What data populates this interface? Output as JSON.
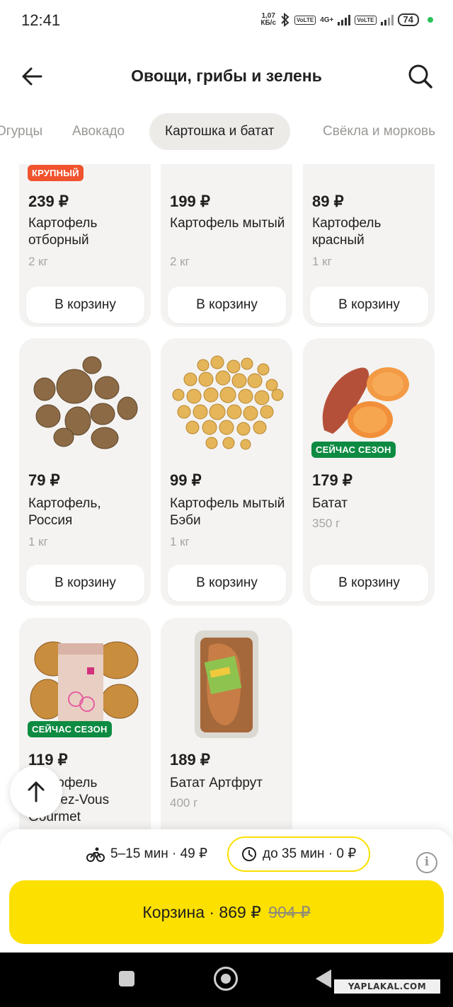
{
  "status_bar": {
    "time": "12:41",
    "net_speed_top": "1,07",
    "net_speed_bottom": "КБ/с",
    "network": "4G+",
    "lte_badge": "VoLTE",
    "battery": "74"
  },
  "header": {
    "title": "Овощи, грибы и зелень",
    "back_icon": "arrow-left-icon",
    "search_icon": "search-icon"
  },
  "tabs": [
    {
      "label": "Огурцы",
      "active": false
    },
    {
      "label": "Авокадо",
      "active": false
    },
    {
      "label": "Картошка и батат",
      "active": true
    },
    {
      "label": "Свёкла и морковь",
      "active": false
    }
  ],
  "products": [
    {
      "price": "239 ₽",
      "name": "Картофель отборный",
      "weight": "2 кг",
      "badge": "КРУПНЫЙ",
      "button": "В корзину"
    },
    {
      "price": "199 ₽",
      "name": "Картофель мытый",
      "weight": "2 кг",
      "badge": "",
      "button": "В корзину"
    },
    {
      "price": "89 ₽",
      "name": "Картофель красный",
      "weight": "1 кг",
      "badge": "",
      "button": "В корзину"
    },
    {
      "price": "79 ₽",
      "name": "Картофель, Россия",
      "weight": "1 кг",
      "badge": "",
      "button": "В корзину"
    },
    {
      "price": "99 ₽",
      "name": "Картофель мытый Бэби",
      "weight": "1 кг",
      "badge": "",
      "button": "В корзину"
    },
    {
      "price": "179 ₽",
      "name": "Батат",
      "weight": "350 г",
      "badge": "СЕЙЧАС СЕЗОН",
      "button": "В корзину"
    },
    {
      "price": "119 ₽",
      "name": "Картофель Rendez-Vous Gourmet",
      "weight": "",
      "badge": "СЕЙЧАС СЕЗОН",
      "button": ""
    },
    {
      "price": "189 ₽",
      "name": "Батат Артфрут",
      "weight": "400 г",
      "badge": "",
      "button": ""
    }
  ],
  "delivery": {
    "fast_label": "5–15 мин · 49 ₽",
    "slow_label": "до 35 мин · 0 ₽",
    "fast_icon": "bicycle-icon",
    "slow_icon": "clock-icon",
    "info_label": "i"
  },
  "cart": {
    "label": "Корзина · 869 ₽",
    "old_price": "904 ₽"
  },
  "watermark": "YAPLAKAL.COM",
  "colors": {
    "accent_yellow": "#fce000",
    "season_badge": "#0d8b42",
    "big_badge": "#f0532e",
    "card_bg": "#f4f3f1"
  }
}
